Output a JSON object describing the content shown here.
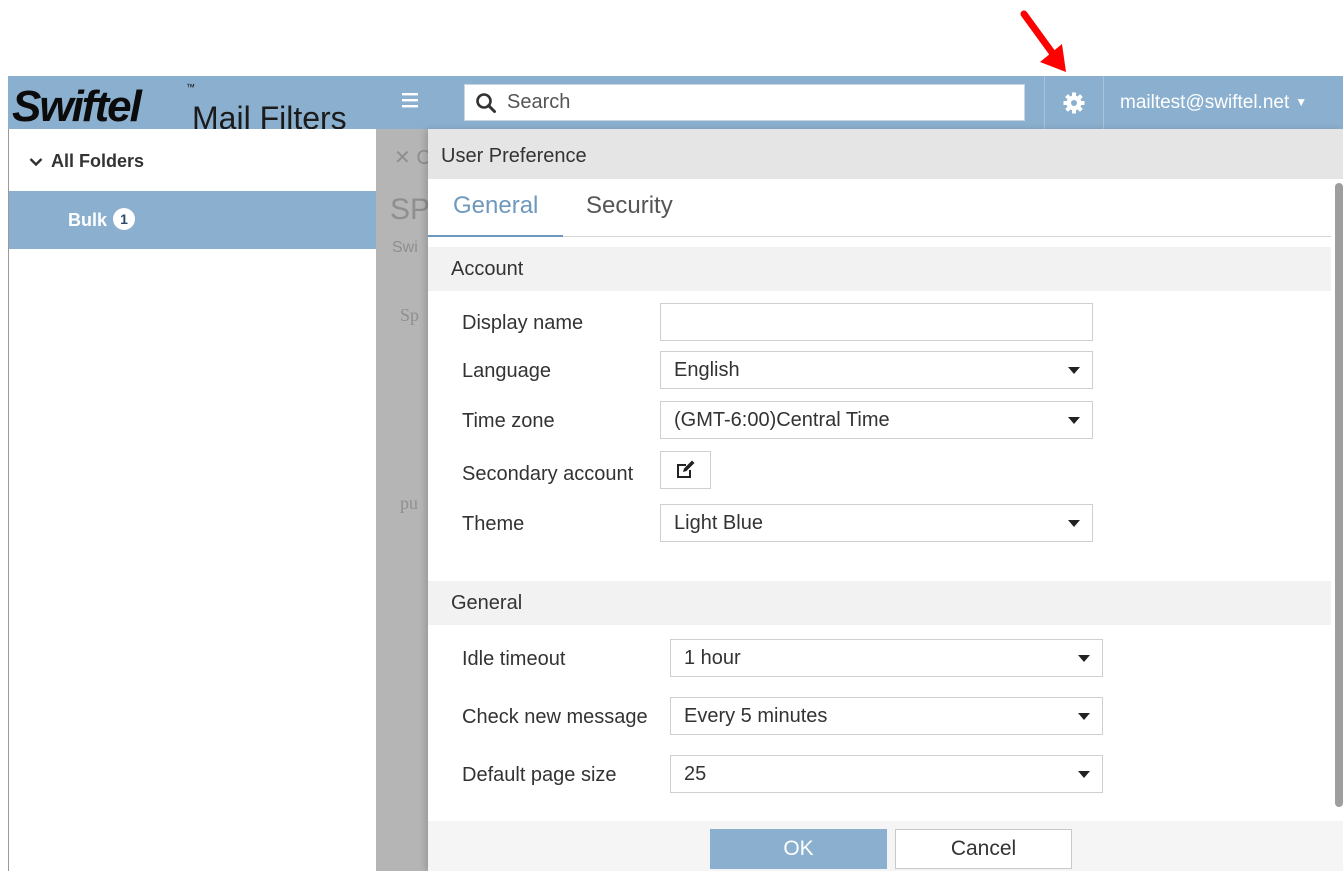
{
  "header": {
    "logo_mark": "Swiftel",
    "logo_tm": "™",
    "logo_text": "Mail Filters",
    "search_placeholder": "Search",
    "account_email": "mailtest@swiftel.net",
    "accent_color": "#8bb0cf"
  },
  "sidebar": {
    "folders_label": "All Folders",
    "items": [
      {
        "label": "Bulk",
        "count": "1"
      }
    ]
  },
  "underlay": {
    "close_label": "✕ C",
    "heading": "SP",
    "subheading": "Swi",
    "text1": "Sp",
    "text2": "pu"
  },
  "dialog": {
    "title": "User Preference",
    "tabs": [
      "General",
      "Security"
    ],
    "account_section": {
      "heading": "Account",
      "display_name_label": "Display name",
      "display_name_value": "",
      "language_label": "Language",
      "language_value": "English",
      "timezone_label": "Time zone",
      "timezone_value": "(GMT-6:00)Central Time",
      "secondary_label": "Secondary account",
      "theme_label": "Theme",
      "theme_value": "Light Blue"
    },
    "general_section": {
      "heading": "General",
      "idle_label": "Idle timeout",
      "idle_value": "1 hour",
      "check_label": "Check new message",
      "check_value": "Every 5 minutes",
      "page_size_label": "Default page size",
      "page_size_value": "25"
    },
    "ok_label": "OK",
    "cancel_label": "Cancel"
  },
  "icons": {
    "arrow": "red-arrow-icon",
    "menu": "hamburger-icon",
    "search": "search-icon",
    "settings": "gear-icon",
    "edit": "edit-icon"
  }
}
